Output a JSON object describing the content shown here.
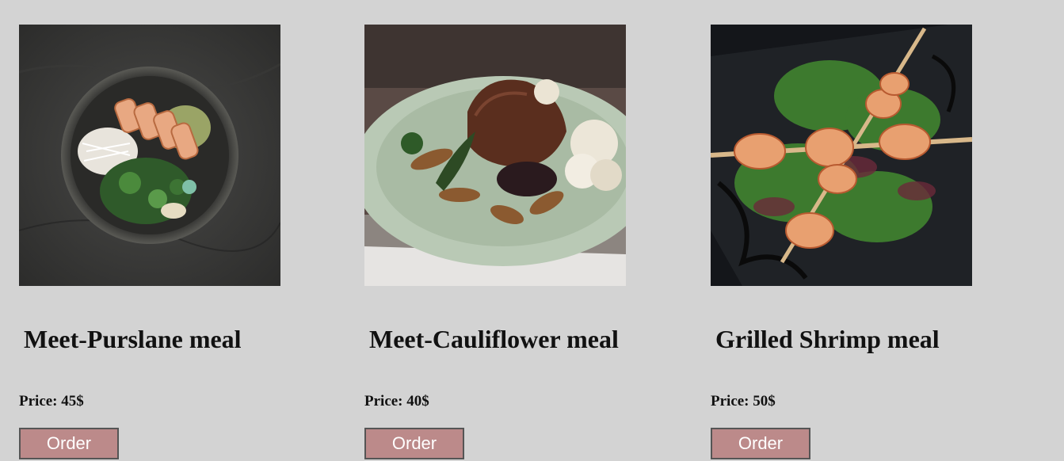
{
  "meals": [
    {
      "name": "Meet-Purslane meal",
      "price": "Price: 45$",
      "order_label": "Order",
      "image_icon": "salmon-bowl-photo"
    },
    {
      "name": "Meet-Cauliflower meal",
      "price": "Price: 40$",
      "order_label": "Order",
      "image_icon": "steak-plate-photo"
    },
    {
      "name": "Grilled Shrimp meal",
      "price": "Price: 50$",
      "order_label": "Order",
      "image_icon": "shrimp-skewer-photo"
    }
  ],
  "colors": {
    "page_bg": "#d3d3d3",
    "button_bg": "#bc8a8a",
    "button_text": "#ffffff"
  }
}
